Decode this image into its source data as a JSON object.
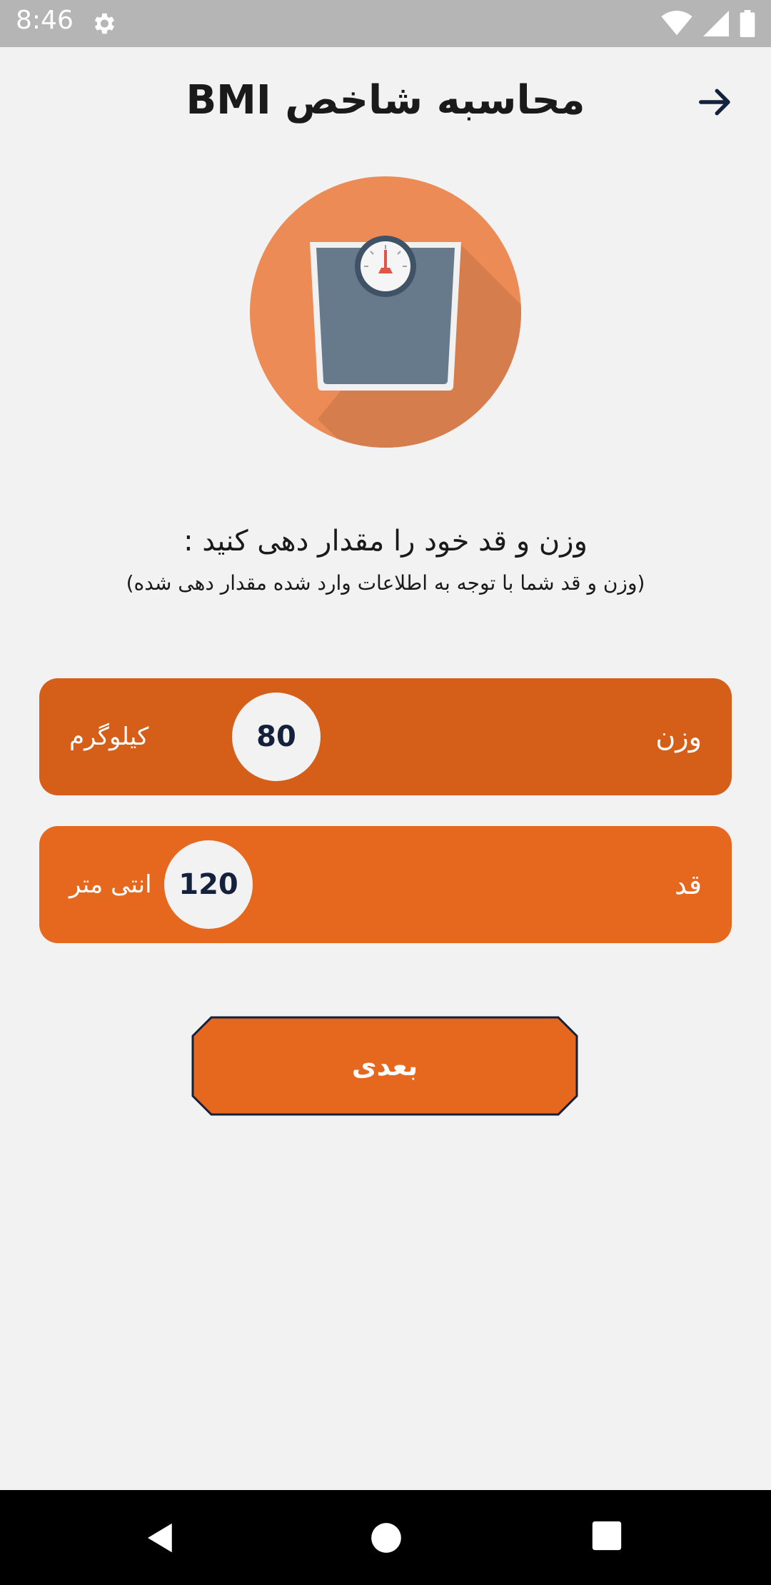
{
  "status_bar": {
    "time": "8:46"
  },
  "header": {
    "title": "محاسبه شاخص BMI"
  },
  "prompt": {
    "title": "وزن و قد خود را مقدار دهی کنید :",
    "subtitle": "(وزن و قد شما با توجه به اطلاعات وارد شده مقدار دهی شده)"
  },
  "weight": {
    "label": "وزن",
    "value": "80",
    "unit": "کیلوگرم"
  },
  "height": {
    "label": "قد",
    "value": "120",
    "unit": "انتی متر"
  },
  "next_button": {
    "label": "بعدی"
  },
  "colors": {
    "weight_bar": "#d55f18",
    "height_bar": "#e5681e",
    "button": "#e5681e",
    "button_border": "#13213c",
    "knob_text": "#13213c"
  },
  "icons": [
    "gear-icon",
    "wifi-icon",
    "signal-icon",
    "battery-icon",
    "arrow-right-icon",
    "scale-icon",
    "nav-back-icon",
    "nav-home-icon",
    "nav-recents-icon"
  ]
}
